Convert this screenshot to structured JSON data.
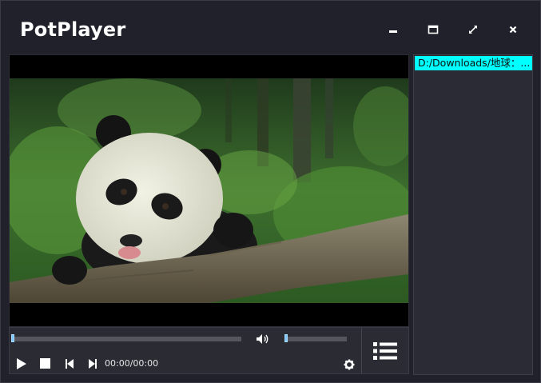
{
  "app": {
    "title": "PotPlayer"
  },
  "window_controls": {
    "icons": [
      "minimize-icon",
      "maximize-icon",
      "fullscreen-icon",
      "close-icon"
    ]
  },
  "player": {
    "time_display": "00:00/00:00",
    "seek_progress": 0,
    "volume_level": 0,
    "icons": [
      "speaker-icon",
      "play-icon",
      "stop-icon",
      "previous-icon",
      "next-icon",
      "settings-icon",
      "playlist-icon"
    ]
  },
  "playlist": {
    "items": [
      {
        "label": "D:/Downloads/地球：...",
        "selected": true
      }
    ]
  },
  "colors": {
    "window_bg": "#20212a",
    "selection_bg": "#00ffff",
    "knob": "#7fc6ff"
  }
}
